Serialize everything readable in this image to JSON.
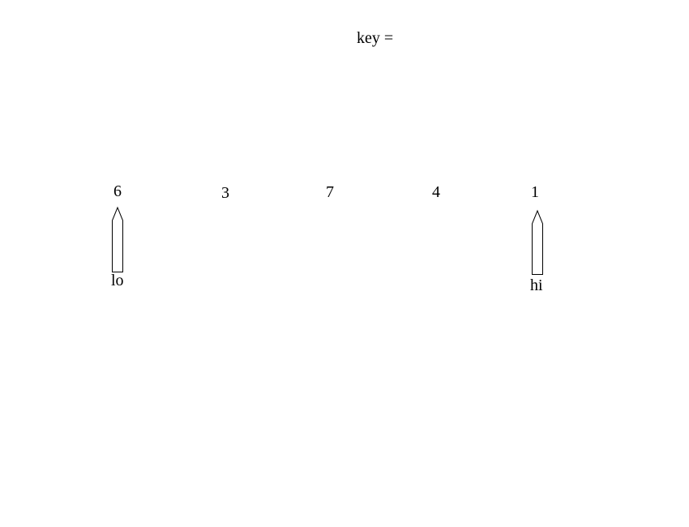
{
  "key": {
    "label": "key ="
  },
  "array": {
    "values": [
      "6",
      "3",
      "7",
      "4",
      "1"
    ]
  },
  "pointers": {
    "lo": {
      "label": "lo",
      "index": 0
    },
    "hi": {
      "label": "hi",
      "index": 4
    }
  }
}
